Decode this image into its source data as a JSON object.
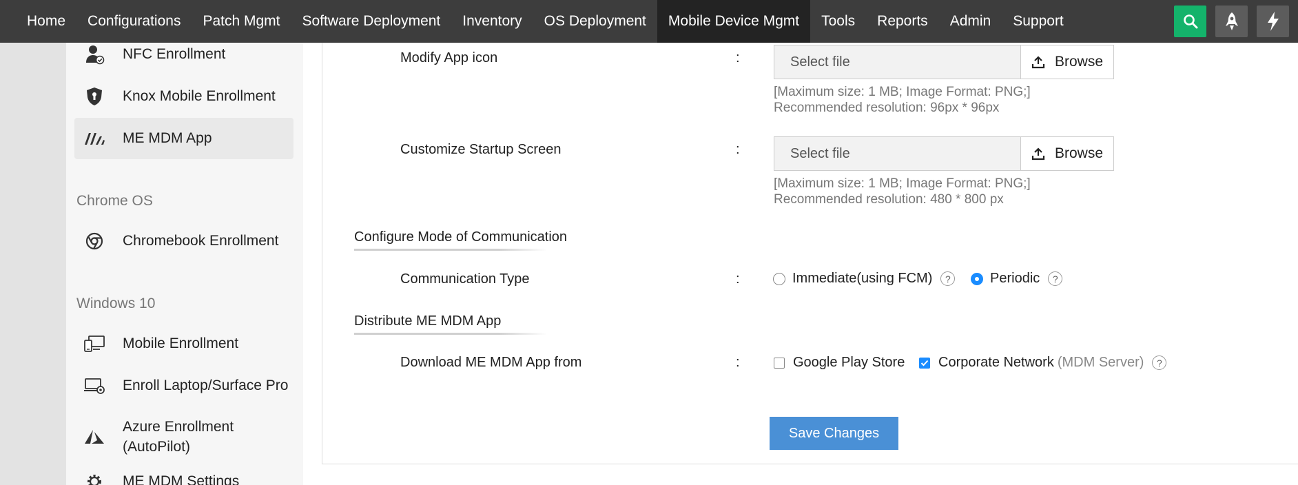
{
  "topnav": {
    "items": [
      {
        "label": "Home",
        "active": false
      },
      {
        "label": "Configurations",
        "active": false
      },
      {
        "label": "Patch Mgmt",
        "active": false
      },
      {
        "label": "Software Deployment",
        "active": false
      },
      {
        "label": "Inventory",
        "active": false
      },
      {
        "label": "OS Deployment",
        "active": false
      },
      {
        "label": "Mobile Device Mgmt",
        "active": true
      },
      {
        "label": "Tools",
        "active": false
      },
      {
        "label": "Reports",
        "active": false
      },
      {
        "label": "Admin",
        "active": false
      },
      {
        "label": "Support",
        "active": false
      }
    ],
    "right_icons": [
      "search-icon",
      "rocket-icon",
      "lightning-icon"
    ],
    "search_color": "#14b36b"
  },
  "sidebar": {
    "items": [
      {
        "label": "NFC Enrollment",
        "icon": "user-check-icon"
      },
      {
        "label": "Knox Mobile Enrollment",
        "icon": "knox-shield-icon"
      },
      {
        "label": "ME MDM App",
        "icon": "me-mdm-logo-icon",
        "active": true
      },
      {
        "label": "Chromebook Enrollment",
        "icon": "chrome-icon"
      },
      {
        "label": "Mobile Enrollment",
        "icon": "devices-icon"
      },
      {
        "label": "Enroll Laptop/Surface Pro",
        "icon": "laptop-gear-icon"
      },
      {
        "label_line1": "Azure Enrollment",
        "label_line2": "(AutoPilot)",
        "icon": "azure-icon"
      },
      {
        "label": "ME MDM Settings",
        "icon": "gear-icon"
      }
    ],
    "headings": {
      "chrome_os": "Chrome OS",
      "windows_10": "Windows 10"
    }
  },
  "form": {
    "modify_icon": {
      "label": "Modify App icon",
      "colon": ":",
      "placeholder": "Select file",
      "browse": "Browse",
      "hint_line1": "[Maximum size: 1 MB; Image Format: PNG;]",
      "hint_line2": "Recommended resolution: 96px * 96px"
    },
    "startup_screen": {
      "label": "Customize Startup Screen",
      "colon": ":",
      "placeholder": "Select file",
      "browse": "Browse",
      "hint_line1": "[Maximum size: 1 MB; Image Format: PNG;]",
      "hint_line2": "Recommended resolution: 480 * 800 px"
    },
    "communication_section": "Configure Mode of Communication",
    "communication": {
      "label": "Communication Type",
      "colon": ":",
      "options": [
        {
          "label": "Immediate(using FCM)",
          "checked": false
        },
        {
          "label": "Periodic",
          "checked": true
        }
      ],
      "help": "?"
    },
    "distribute_section": "Distribute ME MDM App",
    "download": {
      "label": "Download ME MDM App from",
      "colon": ":",
      "google_play": {
        "label": "Google Play Store",
        "checked": false
      },
      "corporate": {
        "label": "Corporate Network",
        "suffix": "(MDM Server)",
        "checked": true
      },
      "help": "?"
    },
    "save_label": "Save Changes",
    "accent_color": "#1a8cff",
    "save_color": "#4a90d6"
  }
}
